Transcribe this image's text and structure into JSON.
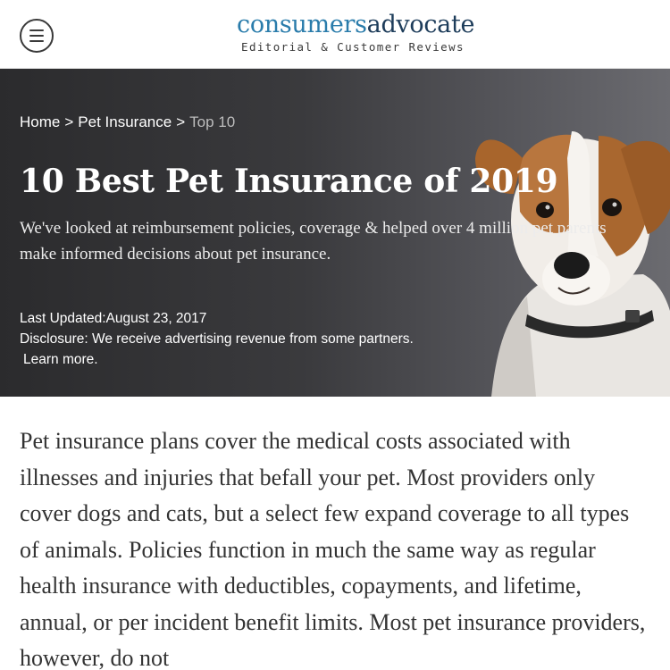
{
  "header": {
    "menu_icon": "hamburger-menu-icon",
    "logo_part1": "consumers",
    "logo_part2": "advocate",
    "logo_tagline": "Editorial & Customer Reviews"
  },
  "breadcrumb": {
    "home": "Home",
    "sep1": ">",
    "pet_insurance": "Pet Insurance",
    "sep2": ">",
    "current": "Top 10"
  },
  "hero": {
    "title": "10 Best Pet Insurance of 2019",
    "subtitle": "We've looked at reimbursement policies, coverage & helped over 4 million pet parents make informed decisions about pet insurance.",
    "last_updated": "Last Updated:August 23, 2017",
    "disclosure": "Disclosure: We receive advertising revenue from some partners.",
    "learn_more": "Learn more."
  },
  "article": {
    "intro": "Pet insurance plans cover the medical costs associated with illnesses and injuries that befall your pet. Most providers only cover dogs and cats, but a select few expand coverage to all types of animals. Policies function in much the same way as regular health insurance with deductibles, copayments, and lifetime, annual, or per incident benefit limits. Most pet insurance providers, however, do not"
  },
  "colors": {
    "logo_blue": "#2a7cab",
    "logo_navy": "#1d3c5a",
    "hero_bg": "#3a3a3d",
    "body_text": "#333333"
  }
}
